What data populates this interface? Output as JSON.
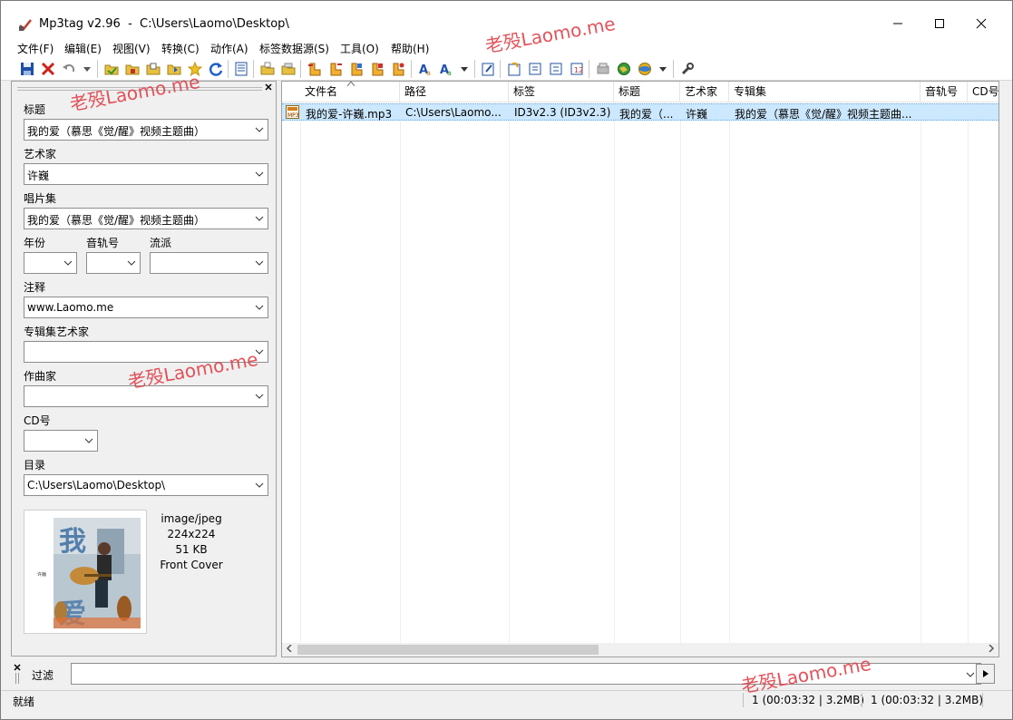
{
  "window": {
    "title": "Mp3tag v2.96  -  C:\\Users\\Laomo\\Desktop\\"
  },
  "menu": [
    "文件(F)",
    "编辑(E)",
    "视图(V)",
    "转换(C)",
    "动作(A)",
    "标签数据源(S)",
    "工具(O)",
    "帮助(H)"
  ],
  "toolbar": {
    "groups": [
      [
        "save-icon",
        "delete-icon",
        "undo-icon"
      ],
      [
        "folder-open-icon",
        "folder-add-icon",
        "folder-icon",
        "folder-star-icon",
        "favorite-star-icon",
        "refresh-icon"
      ],
      [
        "list-icon"
      ],
      [
        "folder-export-icon",
        "folder-import-icon"
      ],
      [
        "tag-to-filename-icon",
        "filename-to-tag-icon",
        "tag-to-tag-icon",
        "text-to-tag-icon",
        "export-icon"
      ],
      [
        "case-convert-icon",
        "case-convert-options-icon"
      ],
      [
        "edit-icon"
      ],
      [
        "autonumber-icon",
        "playlist-icon",
        "playlist-add-icon",
        "numbering-icon"
      ],
      [
        "musicbrainz-icon",
        "web-source-icon",
        "web-source-2-icon"
      ],
      [
        "tools-icon"
      ]
    ]
  },
  "tag_panel": {
    "fields": [
      {
        "label": "标题",
        "value": "我的爱（慕思《觉/醒》视频主题曲）"
      },
      {
        "label": "艺术家",
        "value": "许巍"
      },
      {
        "label": "唱片集",
        "value": "我的爱（慕思《觉/醒》视频主题曲）"
      },
      {
        "label": "注释",
        "value": "www.Laomo.me"
      },
      {
        "label": "专辑集艺术家",
        "value": ""
      },
      {
        "label": "作曲家",
        "value": ""
      }
    ],
    "year_label": "年份",
    "track_label": "音轨号",
    "genre_label": "流派",
    "disc_label": "CD号",
    "dir_label": "目录",
    "dir_value": "C:\\Users\\Laomo\\Desktop\\",
    "cover": {
      "mime": "image/jpeg",
      "dimensions": "224x224",
      "size": "51 KB",
      "type": "Front Cover"
    }
  },
  "file_list": {
    "columns": [
      "文件名",
      "路径",
      "标签",
      "标题",
      "艺术家",
      "专辑集",
      "音轨号",
      "CD号"
    ],
    "rows": [
      {
        "filename": "我的爱-许巍.mp3",
        "path": "C:\\Users\\Laomo...",
        "tag": "ID3v2.3 (ID3v2.3)",
        "title": "我的爱（...",
        "artist": "许巍",
        "album": "我的爱（慕思《觉/醒》视频主题曲..."
      }
    ]
  },
  "filter": {
    "label": "过滤",
    "value": ""
  },
  "status": {
    "left": "就绪",
    "selected": "1 (00:03:32 | 3.2MB)",
    "total": "1 (00:03:32 | 3.2MB)"
  },
  "watermark": "老殁Laomo.me",
  "colors": {
    "selection": "#cce8ff",
    "watermark": "#e0414a"
  }
}
